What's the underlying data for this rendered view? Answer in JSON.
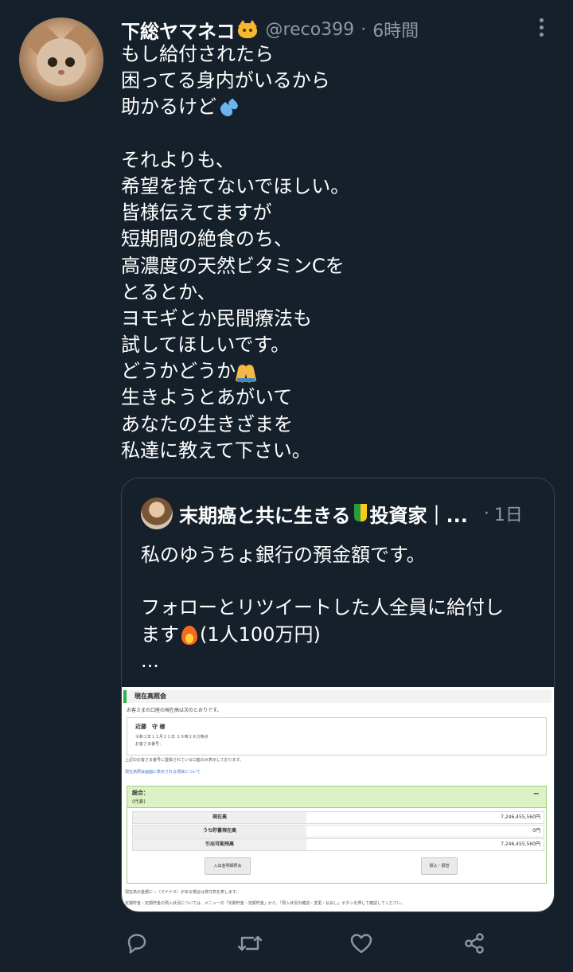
{
  "tweet": {
    "display_name": "下総ヤマネコ",
    "handle": "@reco399",
    "separator": "·",
    "time": "6時間",
    "lines": [
      "もし給付されたら",
      "困ってる身内がいるから",
      "助かるけど",
      "",
      "それよりも、",
      "希望を捨てないでほしい。",
      "皆様伝えてますが",
      "短期間の絶食のち、",
      "高濃度の天然ビタミンCを",
      "とるとか、",
      "ヨモギとか民間療法も",
      "試してほしいです。",
      "どうかどうか",
      "生きようとあがいて",
      "あなたの生きざまを",
      "私達に教えて下さい。"
    ],
    "emojis": {
      "name": "cat-face",
      "line3": "sweat-droplets",
      "line13": "folded-hands"
    }
  },
  "quote": {
    "display_name": "末期癌と共に生きる",
    "display_name_suffix": "投資家｜...",
    "separator": "·",
    "time": "1日",
    "line1": "私のゆうちょ銀行の預金額です。",
    "line2": "フォローとリツイートした人全員に給付し",
    "line3a": "ます",
    "line3b": "(1人100万円)",
    "line4": "...",
    "image": {
      "title": "現在高照会",
      "subtitle": "お客さまの口座の現在高は次のとおりです。",
      "name": "近藤　守 様",
      "date": "令和３年１２月１１日 １９時２８分時点",
      "account": "お客さま番号：",
      "note": "上記のお客さま番号に登録されている口座のみ表示しております。",
      "link": "現在高照会画面に表示される項目について",
      "summary_label": "総合：",
      "summary_sub": "(代表)",
      "rows": [
        {
          "label": "現在高",
          "value": "7,246,455,560円"
        },
        {
          "label": "うち貯蓄現在高",
          "value": "0円"
        },
        {
          "label": "引出可能残高",
          "value": "7,246,455,560円"
        }
      ],
      "button_left": "入出金明細照会",
      "button_right": "振込・振替",
      "foot1": "現在高の金額に－（マイナス）がある場合は貸付高を表します。",
      "foot2": "定期貯金・定額貯金の預入状況については、メニューの「定期貯金・定額貯金」から、「預入状況の確認・変更・払戻し」ボタンを押して確認してください。"
    }
  },
  "actions": [
    "reply-icon",
    "retweet-icon",
    "like-icon",
    "share-icon"
  ],
  "colors": {
    "background": "#15202b",
    "text": "#ffffff",
    "secondary": "#8b98a5",
    "border": "#38444d"
  }
}
